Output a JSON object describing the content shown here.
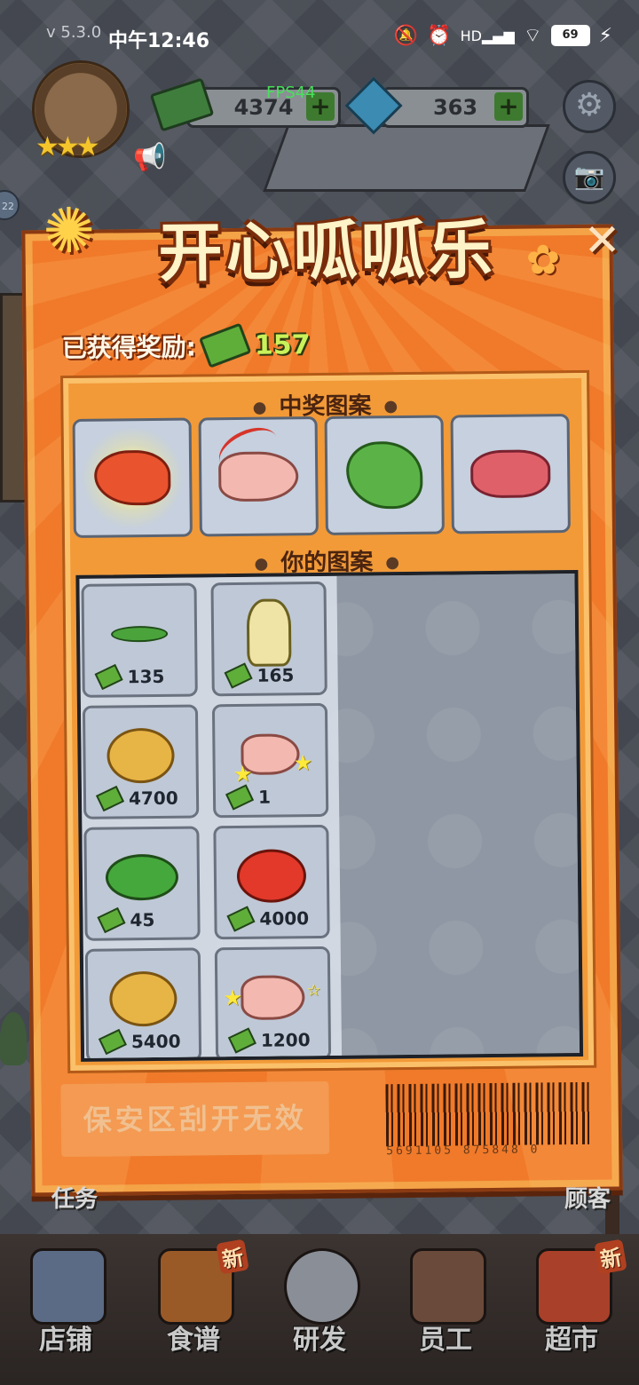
{
  "status_bar": {
    "version": "v 5.3.0",
    "time": "中午12:46",
    "network": "HD",
    "battery": "69"
  },
  "hud": {
    "cash": "4374",
    "gems": "363",
    "fps": "FPS44",
    "side_bubble": "22",
    "plus_symbol": "+"
  },
  "card": {
    "title": "开心呱呱乐",
    "reward_label": "已获得奖励:",
    "reward_value": "157",
    "winning_title": "中奖图案",
    "your_title": "你的图案",
    "winning_items": [
      "shrimp",
      "chicken-leg",
      "lettuce",
      "pork"
    ],
    "cells": [
      {
        "item": "vegetable",
        "prize": "135"
      },
      {
        "item": "bamboo-shoot",
        "prize": "165"
      },
      {
        "item": "potato",
        "prize": "4700"
      },
      {
        "item": "chicken-leg",
        "prize": "1"
      },
      {
        "item": "bok-choy",
        "prize": "45"
      },
      {
        "item": "tomato",
        "prize": "4000"
      },
      {
        "item": "potato",
        "prize": "5400"
      },
      {
        "item": "chicken-leg",
        "prize": "1200"
      }
    ],
    "security_zone": "保安区刮开无效",
    "barcode_number": "5691105  875848 0"
  },
  "bottom": {
    "task_label": "任务",
    "customer_label": "顾客",
    "nav": [
      {
        "label": "店铺",
        "icon": "store-icon",
        "badge": ""
      },
      {
        "label": "食谱",
        "icon": "recipe-book-icon",
        "badge": "新"
      },
      {
        "label": "研发",
        "icon": "cooking-pot-icon",
        "badge": ""
      },
      {
        "label": "员工",
        "icon": "staff-icon",
        "badge": ""
      },
      {
        "label": "超市",
        "icon": "supermarket-icon",
        "badge": "新"
      }
    ]
  },
  "colors": {
    "card_orange": "#f07a2a",
    "reward_green": "#c9f25a",
    "scratch_gray": "#8e97a3"
  }
}
